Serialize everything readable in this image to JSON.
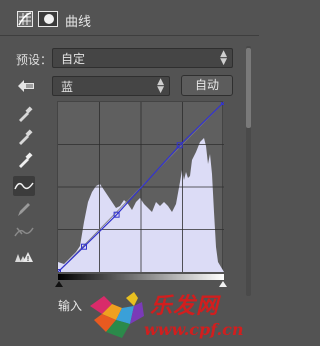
{
  "panel": {
    "title": "曲线",
    "icons": [
      "curves-adjustment-icon",
      "layer-mask-icon"
    ]
  },
  "preset": {
    "label": "预设：",
    "value": "自定"
  },
  "channel": {
    "value": "蓝",
    "auto_label": "自动"
  },
  "tools": [
    "on-image-adjust-icon",
    "black-point-eyedropper-icon",
    "gray-point-eyedropper-icon",
    "white-point-eyedropper-icon",
    "curve-edit-icon",
    "pencil-draw-icon",
    "smooth-curve-icon",
    "clipping-warning-icon"
  ],
  "curve": {
    "channel_color": "#3333cc",
    "points": [
      [
        0,
        0
      ],
      [
        40,
        38
      ],
      [
        90,
        86
      ],
      [
        187,
        190
      ],
      [
        255,
        255
      ]
    ]
  },
  "footer": {
    "input_label": "输入"
  },
  "watermark": {
    "brand": "乐发网",
    "url": "www.cpf.cn"
  }
}
